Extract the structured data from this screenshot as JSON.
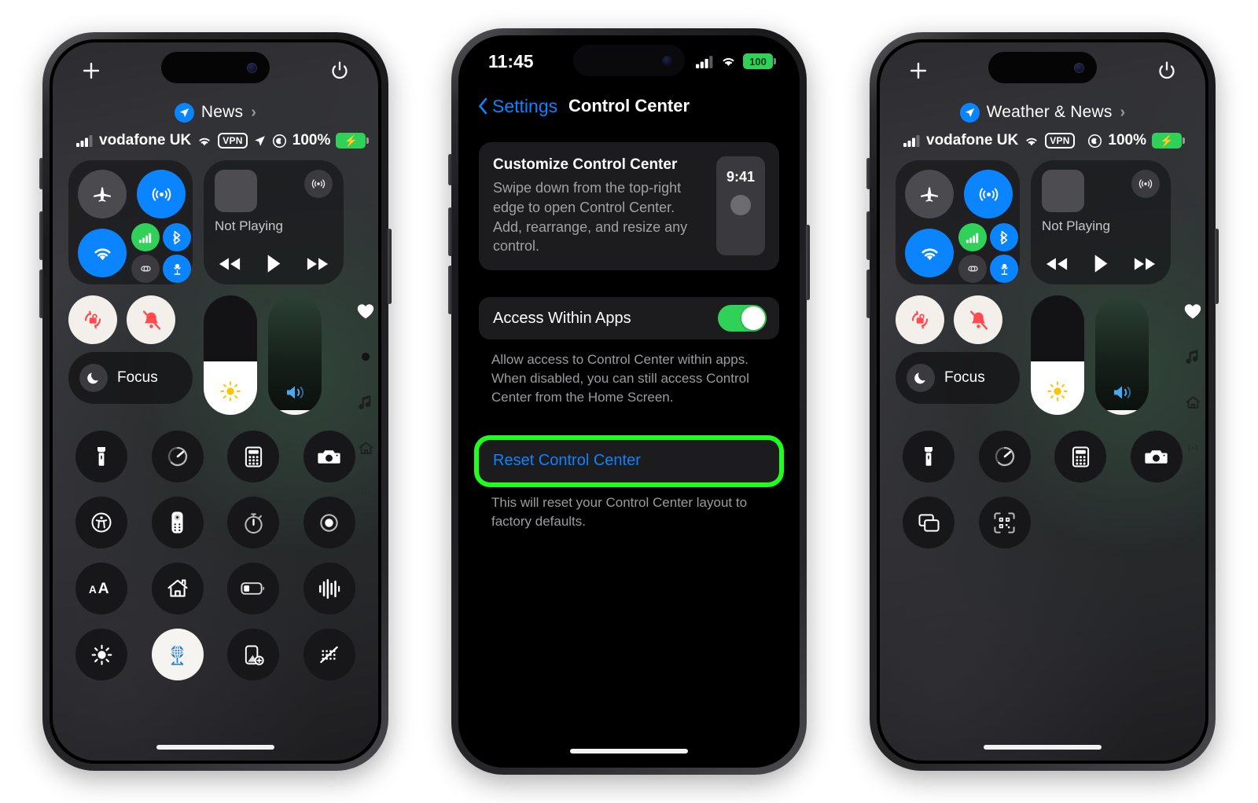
{
  "meta": {
    "accent_blue": "#0a84ff",
    "accent_green": "#30d158",
    "highlight_green": "#1eff1e",
    "toggle_white": "#f3f0ec",
    "icon_dark": "#17171a"
  },
  "phone_left": {
    "name": "control-center-customized",
    "topbar": {
      "add_label": "+",
      "power_label": "power"
    },
    "focus_banner": {
      "label": "News",
      "chevron": "›",
      "icon": "location-arrow-icon"
    },
    "status_bar": {
      "carrier": "vodafone UK",
      "vpn": "VPN",
      "battery_percent": "100%",
      "icons": [
        "cellular-bars-icon",
        "wifi-icon",
        "vpn-badge",
        "location-arrow-icon",
        "focus-circle-icon",
        "battery-charging-icon"
      ]
    },
    "connectivity": [
      {
        "name": "airplane-mode-toggle",
        "icon": "airplane-icon",
        "state": "off",
        "size": "large"
      },
      {
        "name": "airdrop-toggle",
        "icon": "airdrop-icon",
        "state": "on",
        "size": "large"
      },
      {
        "name": "wifi-toggle",
        "icon": "wifi-icon",
        "state": "on",
        "size": "large"
      },
      {
        "name": "cellular-data-toggle",
        "icon": "cellular-bars-icon",
        "state": "on",
        "size": "small"
      },
      {
        "name": "bluetooth-toggle",
        "icon": "bluetooth-icon",
        "state": "on",
        "size": "small"
      },
      {
        "name": "personal-hotspot-toggle",
        "icon": "hotspot-link-icon",
        "state": "off",
        "size": "small"
      },
      {
        "name": "satellite-toggle",
        "icon": "satellite-icon",
        "state": "on",
        "size": "small"
      }
    ],
    "media": {
      "status": "Not Playing",
      "airplay": "airplay-icon",
      "prev": "rewind-icon",
      "play": "play-icon",
      "next": "fast-forward-icon"
    },
    "toggles": [
      {
        "name": "rotation-lock-toggle",
        "icon": "rotation-lock-icon",
        "state": "on"
      },
      {
        "name": "silent-mode-toggle",
        "icon": "bell-slash-icon",
        "state": "on"
      }
    ],
    "focus_pill": {
      "label": "Focus",
      "icon": "moon-icon"
    },
    "sliders": [
      {
        "name": "brightness-slider",
        "icon": "sun-icon",
        "value": 45
      },
      {
        "name": "volume-slider",
        "icon": "speaker-icon",
        "value": 4
      }
    ],
    "icon_grid": [
      {
        "name": "flashlight-button",
        "icon": "flashlight-icon",
        "state": "off"
      },
      {
        "name": "timer-button",
        "icon": "timer-icon",
        "state": "off"
      },
      {
        "name": "calculator-button",
        "icon": "calculator-icon",
        "state": "off"
      },
      {
        "name": "camera-button",
        "icon": "camera-icon",
        "state": "off"
      },
      {
        "name": "accessibility-button",
        "icon": "accessibility-icon",
        "state": "off"
      },
      {
        "name": "apple-tv-remote-button",
        "icon": "remote-icon",
        "state": "off"
      },
      {
        "name": "stopwatch-button",
        "icon": "stopwatch-icon",
        "state": "off"
      },
      {
        "name": "screen-record-button",
        "icon": "record-icon",
        "state": "off"
      },
      {
        "name": "text-size-button",
        "icon": "text-size-icon",
        "state": "off"
      },
      {
        "name": "home-button",
        "icon": "home-icon",
        "state": "off"
      },
      {
        "name": "low-power-mode-button",
        "icon": "battery-low-icon",
        "state": "off"
      },
      {
        "name": "sound-recognition-button",
        "icon": "waveform-icon",
        "state": "off"
      },
      {
        "name": "dark-mode-button",
        "icon": "sun-rays-icon",
        "state": "off"
      },
      {
        "name": "vpn-button",
        "icon": "vpn-globe-icon",
        "state": "on"
      },
      {
        "name": "screen-mirroring-add-button",
        "icon": "device-add-icon",
        "state": "off"
      },
      {
        "name": "live-text-button",
        "icon": "live-text-slash-icon",
        "state": "off"
      }
    ],
    "page_dots": [
      {
        "name": "page-favorites",
        "icon": "heart-icon",
        "active": true
      },
      {
        "name": "page-connectivity",
        "icon": "dot-icon",
        "active": false
      },
      {
        "name": "page-media",
        "icon": "music-note-icon",
        "active": false
      },
      {
        "name": "page-home",
        "icon": "home-small-icon",
        "active": false
      },
      {
        "name": "page-broadcast",
        "icon": "broadcast-icon",
        "active": false
      }
    ]
  },
  "phone_mid": {
    "name": "settings-control-center",
    "status_bar": {
      "time": "11:45",
      "battery_percent": "100",
      "icons": [
        "cellular-bars-icon",
        "wifi-icon",
        "battery-icon"
      ]
    },
    "navbar": {
      "back_label": "Settings",
      "back_icon": "chevron-left-icon",
      "title": "Control Center"
    },
    "card": {
      "heading": "Customize Control Center",
      "body": "Swipe down from the top-right edge to open Control Center. Add, rearrange, and resize any control.",
      "preview_time": "9:41"
    },
    "access_row": {
      "label": "Access Within Apps",
      "toggle_state": "on"
    },
    "access_footnote": "Allow access to Control Center within apps. When disabled, you can still access Control Center from the Home Screen.",
    "reset_row": {
      "label": "Reset Control Center",
      "highlighted": true
    },
    "reset_footnote": "This will reset your Control Center layout to factory defaults."
  },
  "phone_right": {
    "name": "control-center-default",
    "topbar": {
      "add_label": "+",
      "power_label": "power"
    },
    "focus_banner": {
      "label": "Weather & News",
      "chevron": "›",
      "icon": "location-arrow-icon"
    },
    "status_bar": {
      "carrier": "vodafone UK",
      "vpn": "VPN",
      "battery_percent": "100%",
      "icons": [
        "cellular-bars-icon",
        "wifi-icon",
        "vpn-badge",
        "focus-circle-icon",
        "battery-charging-icon"
      ]
    },
    "connectivity": [
      {
        "name": "airplane-mode-toggle",
        "icon": "airplane-icon",
        "state": "off",
        "size": "large"
      },
      {
        "name": "airdrop-toggle",
        "icon": "airdrop-icon",
        "state": "on",
        "size": "large"
      },
      {
        "name": "wifi-toggle",
        "icon": "wifi-icon",
        "state": "on",
        "size": "large"
      },
      {
        "name": "cellular-data-toggle",
        "icon": "cellular-bars-icon",
        "state": "on",
        "size": "small"
      },
      {
        "name": "bluetooth-toggle",
        "icon": "bluetooth-icon",
        "state": "on",
        "size": "small"
      },
      {
        "name": "personal-hotspot-toggle",
        "icon": "hotspot-link-icon",
        "state": "off",
        "size": "small"
      },
      {
        "name": "satellite-toggle",
        "icon": "satellite-icon",
        "state": "on",
        "size": "small"
      }
    ],
    "media": {
      "status": "Not Playing",
      "airplay": "airplay-icon",
      "prev": "rewind-icon",
      "play": "play-icon",
      "next": "fast-forward-icon"
    },
    "toggles": [
      {
        "name": "rotation-lock-toggle",
        "icon": "rotation-lock-icon",
        "state": "on"
      },
      {
        "name": "silent-mode-toggle",
        "icon": "bell-slash-icon",
        "state": "on"
      }
    ],
    "focus_pill": {
      "label": "Focus",
      "icon": "moon-icon"
    },
    "sliders": [
      {
        "name": "brightness-slider",
        "icon": "sun-icon",
        "value": 45
      },
      {
        "name": "volume-slider",
        "icon": "speaker-icon",
        "value": 4
      }
    ],
    "icon_grid": [
      {
        "name": "flashlight-button",
        "icon": "flashlight-icon",
        "state": "off"
      },
      {
        "name": "timer-button",
        "icon": "timer-icon",
        "state": "off"
      },
      {
        "name": "calculator-button",
        "icon": "calculator-icon",
        "state": "off"
      },
      {
        "name": "camera-button",
        "icon": "camera-icon",
        "state": "off"
      },
      {
        "name": "screen-mirroring-button",
        "icon": "screen-mirroring-icon",
        "state": "off"
      },
      {
        "name": "code-scanner-button",
        "icon": "qr-scanner-icon",
        "state": "off"
      }
    ],
    "page_dots": [
      {
        "name": "page-favorites",
        "icon": "heart-icon",
        "active": true
      },
      {
        "name": "page-media",
        "icon": "music-note-icon",
        "active": false
      },
      {
        "name": "page-home",
        "icon": "home-small-icon",
        "active": false
      },
      {
        "name": "page-broadcast",
        "icon": "broadcast-icon",
        "active": false
      }
    ]
  }
}
